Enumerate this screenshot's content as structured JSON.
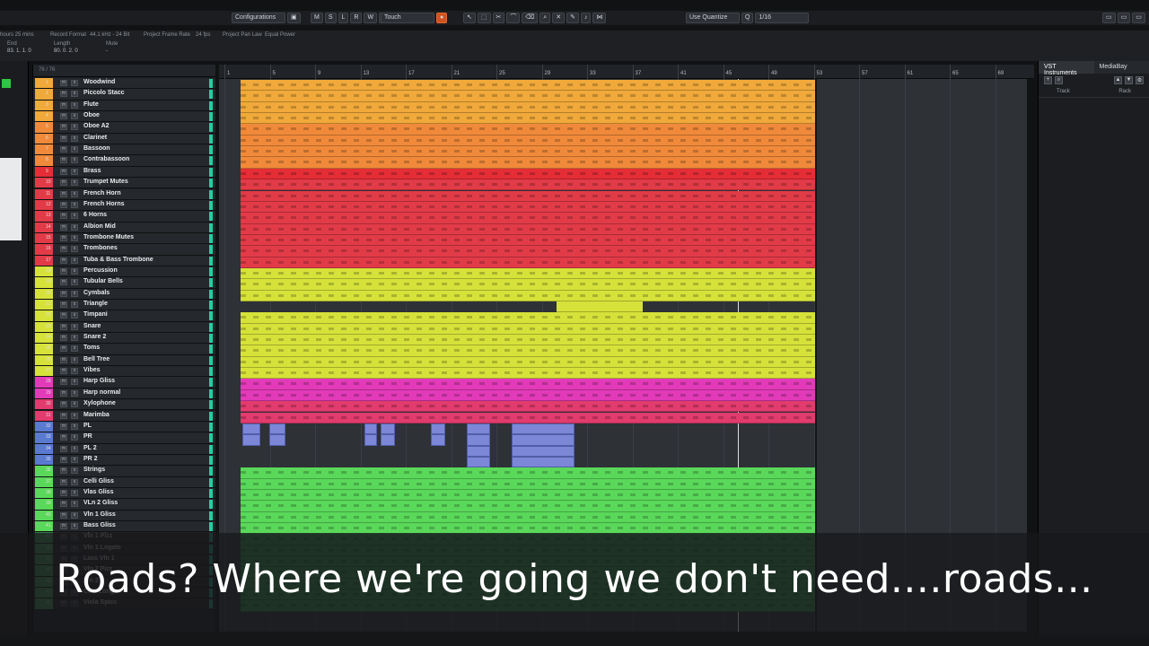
{
  "toolbar": {
    "configurations": "Configurations",
    "mode_buttons": [
      "M",
      "S",
      "L",
      "R",
      "W",
      "A"
    ],
    "automation_mode": "Touch",
    "quantize_label": "Use Quantize",
    "quantize_value": "1/16"
  },
  "info_line": {
    "remaining": "hours 25 mins",
    "record_format_label": "Record Format",
    "record_format_value": "44.1 kHz - 24 Bit",
    "frame_rate_label": "Project Frame Rate",
    "frame_rate_value": "24 fps",
    "pan_law_label": "Project Pan Law",
    "pan_law_value": "Equal Power",
    "end_label": "End",
    "length_label": "Length",
    "mute_label": "Mute",
    "end_value": "83. 1. 1. 0",
    "length_value": "80. 0. 2. 0",
    "mute_value": "-"
  },
  "tracklist": {
    "header": "76 / 76",
    "tracks": [
      {
        "num": "1",
        "name": "Woodwind",
        "color": "#f0a93a"
      },
      {
        "num": "2",
        "name": "Piccolo Stacc",
        "color": "#f0a93a"
      },
      {
        "num": "3",
        "name": "Flute",
        "color": "#f0a93a"
      },
      {
        "num": "4",
        "name": "Oboe",
        "color": "#f0a93a"
      },
      {
        "num": "5",
        "name": "Oboe A2",
        "color": "#f08a3a"
      },
      {
        "num": "6",
        "name": "Clarinet",
        "color": "#f08a3a"
      },
      {
        "num": "7",
        "name": "Bassoon",
        "color": "#f08a3a"
      },
      {
        "num": "8",
        "name": "Contrabassoon",
        "color": "#f08a3a"
      },
      {
        "num": "9",
        "name": "Brass",
        "color": "#e52d36"
      },
      {
        "num": "10",
        "name": "Trumpet Mutes",
        "color": "#e23b48"
      },
      {
        "num": "11",
        "name": "French Horn",
        "color": "#e23b48"
      },
      {
        "num": "12",
        "name": "French Horns",
        "color": "#e23b48"
      },
      {
        "num": "13",
        "name": "6 Horns",
        "color": "#e23b48"
      },
      {
        "num": "14",
        "name": "Albion Mid",
        "color": "#e23b48"
      },
      {
        "num": "15",
        "name": "Trombone Mutes",
        "color": "#e23b48"
      },
      {
        "num": "16",
        "name": "Trombones",
        "color": "#e23b48"
      },
      {
        "num": "17",
        "name": "Tuba & Bass Trombone",
        "color": "#e23b48"
      },
      {
        "num": "18",
        "name": "Percussion",
        "color": "#d6e23a"
      },
      {
        "num": "19",
        "name": "Tubular Bells",
        "color": "#d6e23a"
      },
      {
        "num": "20",
        "name": "Cymbals",
        "color": "#d6e23a"
      },
      {
        "num": "21",
        "name": "Triangle",
        "color": "#d6e23a"
      },
      {
        "num": "22",
        "name": "Timpani",
        "color": "#d6e23a"
      },
      {
        "num": "23",
        "name": "Snare",
        "color": "#d6e23a"
      },
      {
        "num": "24",
        "name": "Snare 2",
        "color": "#d6e23a"
      },
      {
        "num": "25",
        "name": "Toms",
        "color": "#d6e23a"
      },
      {
        "num": "26",
        "name": "Bell Tree",
        "color": "#d6e23a"
      },
      {
        "num": "27",
        "name": "Vibes",
        "color": "#d6e23a"
      },
      {
        "num": "28",
        "name": "Harp Gliss",
        "color": "#e23ab8"
      },
      {
        "num": "29",
        "name": "Harp normal",
        "color": "#e23ab8"
      },
      {
        "num": "30",
        "name": "Xylophone",
        "color": "#e23b6e"
      },
      {
        "num": "31",
        "name": "Marimba",
        "color": "#e23b6e"
      },
      {
        "num": "32",
        "name": "PL",
        "color": "#5a7ad0"
      },
      {
        "num": "33",
        "name": "PR",
        "color": "#5a7ad0"
      },
      {
        "num": "34",
        "name": "PL 2",
        "color": "#5a7ad0"
      },
      {
        "num": "35",
        "name": "PR 2",
        "color": "#5a7ad0"
      },
      {
        "num": "36",
        "name": "Strings",
        "color": "#5ad85a"
      },
      {
        "num": "37",
        "name": "Celli Gliss",
        "color": "#5ad85a"
      },
      {
        "num": "38",
        "name": "Vlas Gliss",
        "color": "#5ad85a"
      },
      {
        "num": "39",
        "name": "VLn 2 Gliss",
        "color": "#5ad85a"
      },
      {
        "num": "40",
        "name": "Vln 1 Gliss",
        "color": "#5ad85a"
      },
      {
        "num": "41",
        "name": "Bass Gliss",
        "color": "#5ad85a"
      },
      {
        "num": "42",
        "name": "Vln 1 Pizz",
        "color": "#4cbf6a"
      },
      {
        "num": "43",
        "name": "Vln 1 Legato",
        "color": "#4cbf6a"
      },
      {
        "num": "44",
        "name": "Lass Vln 1",
        "color": "#4cbf6a"
      },
      {
        "num": "45",
        "name": "Vln 2 Pizz",
        "color": "#4cbf6a"
      },
      {
        "num": "46",
        "name": "Vln 2",
        "color": "#4cbf6a"
      },
      {
        "num": "47",
        "name": "Celli Long",
        "color": "#4cbf6a"
      },
      {
        "num": "48",
        "name": "Viola Spicc",
        "color": "#4cbf6a"
      }
    ]
  },
  "ruler": {
    "bars": [
      "1",
      "5",
      "9",
      "13",
      "17",
      "21",
      "25",
      "29",
      "33",
      "37",
      "41",
      "45",
      "49",
      "53",
      "57",
      "61",
      "65",
      "69"
    ]
  },
  "right_zone": {
    "tabs": [
      "VST Instruments",
      "MediaBay"
    ],
    "columns": [
      "Track",
      "Rack"
    ]
  },
  "caption": "Roads? Where we're going we don't need....roads..."
}
